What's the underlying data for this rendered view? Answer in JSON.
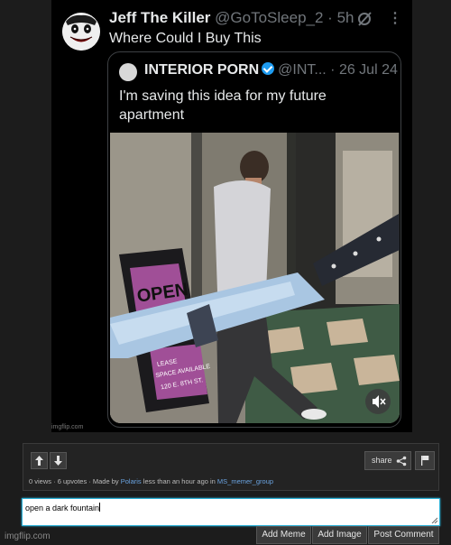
{
  "tweet": {
    "name": "Jeff The Killer",
    "handle": "@GoToSleep_2",
    "separator": "·",
    "time": "5h",
    "text": "Where Could I Buy This",
    "icons": [
      "jeff-avatar",
      "grok-icon",
      "more-options-icon"
    ]
  },
  "quoted": {
    "name": "INTERIOR PORN",
    "handle": "@INT...",
    "separator": "·",
    "date": "26 Jul 24",
    "text": "I'm saving this idea for my future apartment",
    "icons": [
      "verified-badge",
      "mute-icon"
    ]
  },
  "photo": {
    "sign_text": "OPEN",
    "sign_subtext": [
      "LEASE",
      "SPACE AVAILABLE",
      "120 E. 8TH ST."
    ]
  },
  "watermark": "imgflip.com",
  "toolbar": {
    "share_label": "share",
    "meta": {
      "views": "0 views",
      "dot1": " · ",
      "upvotes": "6 upvotes",
      "dot2": " · ",
      "made_by": "Made by ",
      "user": "Polaris",
      "time": " less than an hour ago in ",
      "stream": "MS_memer_group"
    }
  },
  "comment": {
    "value": "open a dark fountain",
    "buttons": {
      "add_meme": "Add Meme",
      "add_image": "Add Image",
      "post_comment": "Post Comment"
    }
  },
  "footer_logo": "imgflip.com",
  "colors": {
    "background": "#1c1c1c",
    "link": "#6aa3e0",
    "input_focus": "#2ab0d6",
    "verified": "#1d9bf0"
  }
}
